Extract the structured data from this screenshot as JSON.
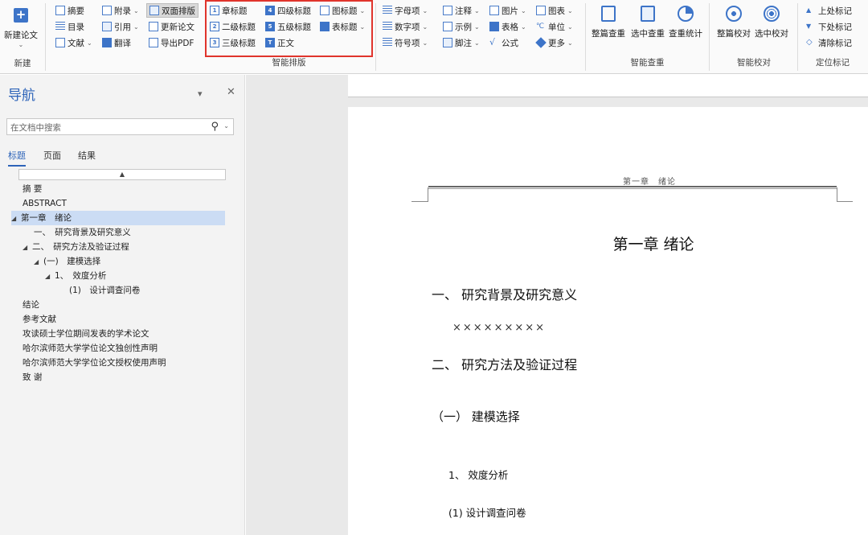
{
  "ribbon": {
    "new_paper": {
      "label": "新建论文",
      "group": "新建"
    },
    "col1": [
      "摘要",
      "目录",
      "文献"
    ],
    "col2": [
      "附录",
      "引用",
      "翻译"
    ],
    "col3": [
      "双面排版",
      "更新论文",
      "导出PDF"
    ],
    "smart_layout": {
      "items": [
        "章标题",
        "二级标题",
        "三级标题",
        "四级标题",
        "五级标题",
        "正文",
        "图标题",
        "表标题"
      ],
      "group": "智能排版"
    },
    "col5": [
      "字母项",
      "数字项",
      "符号项"
    ],
    "col6": [
      "注释",
      "示例",
      "脚注"
    ],
    "col7": [
      "图片",
      "表格",
      "公式"
    ],
    "col8": [
      "图表",
      "单位",
      "更多"
    ],
    "smart_check": {
      "items": [
        "整篇查重",
        "选中查重",
        "查重统计"
      ],
      "group": "智能查重"
    },
    "smart_proof": {
      "items": [
        "整篇校对",
        "选中校对"
      ],
      "group": "智能校对"
    },
    "marks": {
      "items": [
        "上处标记",
        "下处标记",
        "清除标记"
      ],
      "group": "定位标记"
    }
  },
  "nav": {
    "title": "导航",
    "search_placeholder": "在文档中搜索",
    "tabs": [
      "标题",
      "页面",
      "结果"
    ],
    "tree": [
      "摘 要",
      "ABSTRACT",
      "第一章　绪论",
      "一、　研究背景及研究意义",
      "二、　研究方法及验证过程",
      "(一)　建模选择",
      "1、　效度分析",
      "(1)　设计调查问卷",
      "结论",
      "参考文献",
      "攻读硕士学位期间发表的学术论文",
      "哈尔滨师范大学学位论文独创性声明",
      "哈尔滨师范大学学位论文授权使用声明",
      "致 谢"
    ]
  },
  "document": {
    "header": "第一章　绪论",
    "chapter_title": "第一章  绪论",
    "h1_a": "一、  研究背景及研究意义",
    "body": "×××××××××",
    "h1_b": "二、  研究方法及验证过程",
    "h2": "（一）   建模选择",
    "h3_a": "1、   效度分析",
    "h3_b": "(1) 设计调查问卷"
  },
  "colors": {
    "accent": "#2e64b9",
    "highlight_box": "#e0342c",
    "selected_row": "#cbdcf4"
  }
}
